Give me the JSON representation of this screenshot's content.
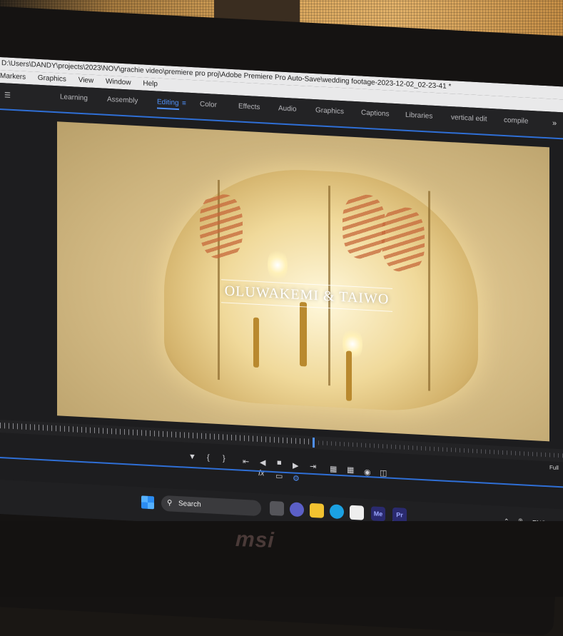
{
  "window": {
    "title_path": "D:\\Users\\DANDY\\projects\\2023\\NOV\\grachie video\\premiere pro proj\\Adobe Premiere Pro Auto-Save\\wedding footage-2023-12-02_02-23-41 *"
  },
  "menubar": {
    "items": [
      "Markers",
      "Graphics",
      "View",
      "Window",
      "Help"
    ]
  },
  "workspaces": {
    "items": [
      "Learning",
      "Assembly",
      "Editing",
      "Color",
      "Effects",
      "Audio",
      "Graphics",
      "Captions",
      "Libraries",
      "vertical edit",
      "compile"
    ],
    "active": "Editing",
    "more_icon": "chevron-double-right-icon",
    "menu_icon": "hamburger-icon"
  },
  "program_monitor": {
    "overlay_title": "OLUWAKEMI & TAIWO",
    "zoom_label": "Full"
  },
  "transport": {
    "buttons": [
      "add-marker",
      "mark-in",
      "mark-out",
      "go-to-in",
      "step-back",
      "stop",
      "step-forward",
      "go-to-out",
      "insert",
      "overwrite",
      "export-frame",
      "compare"
    ],
    "fx_label": "fx"
  },
  "taskbar": {
    "search_placeholder": "Search",
    "apps": [
      {
        "name": "task-view",
        "label": ""
      },
      {
        "name": "chat",
        "label": ""
      },
      {
        "name": "file-explorer",
        "label": ""
      },
      {
        "name": "edge",
        "label": ""
      },
      {
        "name": "store",
        "label": ""
      },
      {
        "name": "media-encoder",
        "label": "Me"
      },
      {
        "name": "premiere-pro",
        "label": "Pr"
      }
    ],
    "language": "ENG"
  },
  "device": {
    "brand": "msi"
  },
  "colors": {
    "accent": "#4f8ff7",
    "panel_bg": "#232325",
    "media_encoder": "#2a2a6e",
    "premiere": "#2a2a6e"
  }
}
